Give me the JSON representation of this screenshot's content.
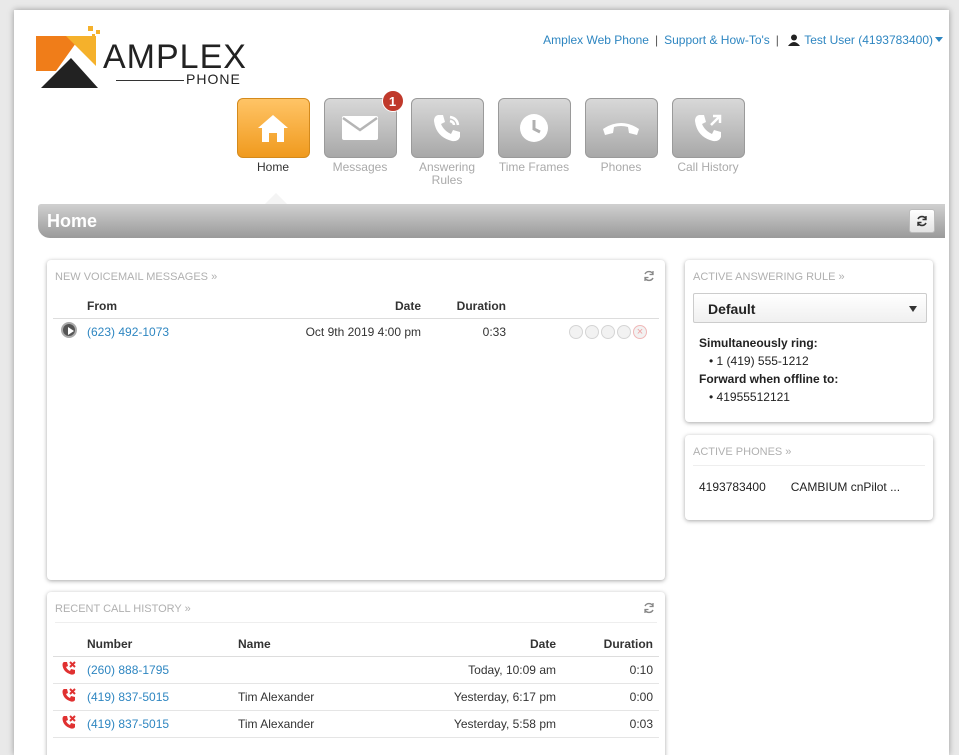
{
  "brand": {
    "logo_word": "AMPLEX",
    "logo_sub": "PHONE",
    "accent": "#f5a623",
    "link": "#2e86c1"
  },
  "top_links": {
    "web_phone": "Amplex Web Phone",
    "support": "Support & How-To's",
    "user": "Test User (4193783400)"
  },
  "nav": [
    {
      "label": "Home",
      "icon": "home-icon",
      "active": true
    },
    {
      "label": "Messages",
      "icon": "envelope-icon",
      "badge": "1"
    },
    {
      "label": "Answering Rules",
      "icon": "phone-forward-icon"
    },
    {
      "label": "Time Frames",
      "icon": "clock-icon"
    },
    {
      "label": "Phones",
      "icon": "handset-icon"
    },
    {
      "label": "Call History",
      "icon": "call-history-icon"
    }
  ],
  "page_title": "Home",
  "voicemail": {
    "title": "NEW VOICEMAIL MESSAGES »",
    "headers": {
      "from": "From",
      "date": "Date",
      "duration": "Duration"
    },
    "rows": [
      {
        "from": "(623) 492-1073",
        "date": "Oct 9th 2019 4:00 pm",
        "duration": "0:33"
      }
    ]
  },
  "call_history": {
    "title": "RECENT CALL HISTORY »",
    "headers": {
      "number": "Number",
      "name": "Name",
      "date": "Date",
      "duration": "Duration"
    },
    "rows": [
      {
        "number": "(260) 888-1795",
        "name": "",
        "date": "Today, 10:09 am",
        "duration": "0:10"
      },
      {
        "number": "(419) 837-5015",
        "name": "Tim Alexander",
        "date": "Yesterday, 6:17 pm",
        "duration": "0:00"
      },
      {
        "number": "(419) 837-5015",
        "name": "Tim Alexander",
        "date": "Yesterday, 5:58 pm",
        "duration": "0:03"
      }
    ]
  },
  "answering_rule": {
    "title": "ACTIVE ANSWERING RULE »",
    "selected": "Default",
    "sim_ring_label": "Simultaneously ring:",
    "sim_ring": [
      "1 (419) 555-1212"
    ],
    "forward_label": "Forward when offline to:",
    "forward": [
      "41955512121"
    ]
  },
  "active_phones": {
    "title": "ACTIVE PHONES »",
    "rows": [
      {
        "number": "4193783400",
        "model": "CAMBIUM cnPilot ..."
      }
    ]
  }
}
